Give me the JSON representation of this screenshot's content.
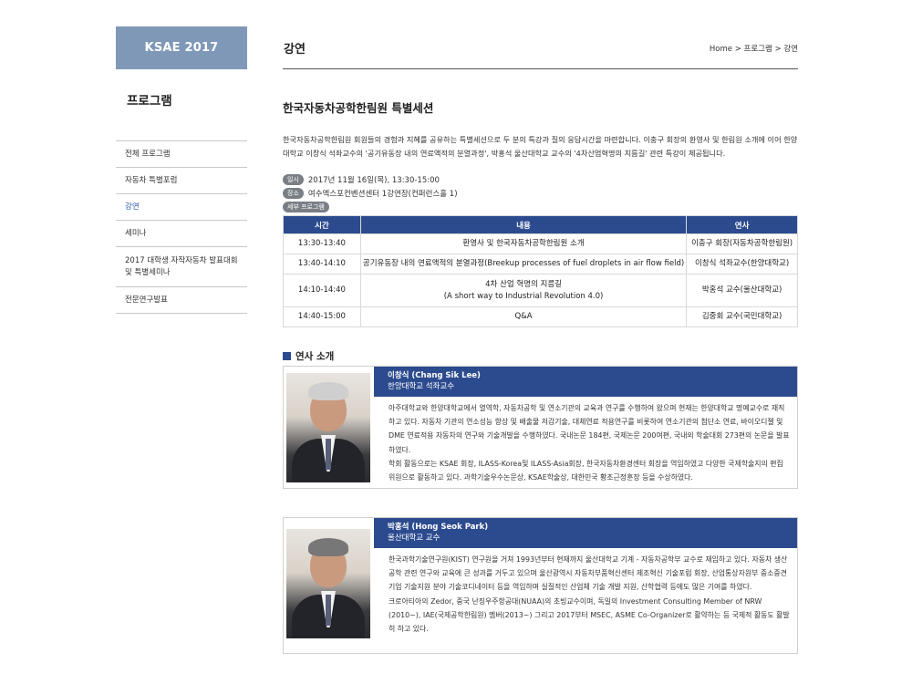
{
  "sidebar": {
    "logo": "KSAE 2017",
    "title": "프로그램",
    "items": [
      {
        "label": "전체 프로그램",
        "active": false
      },
      {
        "label": "자동차 특별포럼",
        "active": false
      },
      {
        "label": "강연",
        "active": true
      },
      {
        "label": "세미나",
        "active": false
      },
      {
        "label": "2017 대학생 자작자동차 발표대회 및 특별세미나",
        "active": false
      },
      {
        "label": "전문연구발표",
        "active": false
      }
    ]
  },
  "header": {
    "title": "강연",
    "breadcrumb": [
      "Home",
      "프로그램",
      "강연"
    ],
    "breadcrumb_sep": " > "
  },
  "section": {
    "title": "한국자동차공학한림원 특별세션",
    "intro": "한국자동차공학한림원 회원들의 경험과 지혜를 공유하는 특별세션으로 두 분의 특강과 질의 응답시간을 마련합니다. 이충구 회장의 환영사 및 한림원 소개에 이어 한양대학교 이창식 석좌교수의 '공기유동장 내의 연료액적의 분열과정', 박홍석 울산대학교 교수의 '4차산업혁명의 지름길' 관련 특강이 제공됩니다.",
    "date_tag": "일시",
    "date": "2017년 11월 16일(목), 13:30-15:00",
    "place_tag": "장소",
    "place": "여수엑스포컨벤션센터 1강연장(컨퍼런스홀 1)",
    "detail_tag": "세부 프로그램"
  },
  "schedule": {
    "headers": [
      "시간",
      "내용",
      "연사"
    ],
    "rows": [
      {
        "time": "13:30-13:40",
        "content": "환영사 및 한국자동차공학한림원 소개",
        "content2": "",
        "speaker": "이충구 회장(자동차공학한림원)"
      },
      {
        "time": "13:40-14:10",
        "content": "공기유동장 내의 연료액적의 분열과정(Breekup processes of fuel droplets in air flow field)",
        "content2": "",
        "speaker": "이창식 석좌교수(한양대학교)"
      },
      {
        "time": "14:10-14:40",
        "content": "4차 산업 혁명의 지름길",
        "content2": "(A short way to Industrial Revolution 4.0)",
        "speaker": "박홍석 교수(울산대학교)"
      },
      {
        "time": "14:40-15:00",
        "content": "Q&A",
        "content2": "",
        "speaker": "김중회 교수(국민대학교)"
      }
    ]
  },
  "speakers_heading": "연사 소개",
  "speakers": [
    {
      "name": "이창식 (Chang Sik Lee)",
      "affiliation": "한양대학교 석좌교수",
      "bio": "아주대학교와 한양대학교에서 열역학, 자동차공학 및 연소기관의 교육과 연구를 수행하여 왔으며 현재는 한양대학교 명예교수로 재직하고 있다. 자동차 기관의 연소성능 향상 및 배출물 저감기술, 대체연료 적용연구를 비롯하여 연소기관의 첨단소 연료, 바이오디젤 및 DME 연료적용 자동차의 연구와 기술개발을 수행하였다. 국내논문 184편, 국제논문 200여편, 국내외 학술대회 273편의 논문을 발표하였다.\n학회 활동으로는 KSAE 회장, ILASS-Korea및 ILASS-Asia회장, 한국자동차환경센터 회장을 역임하였고 다양한 국제학술지의 편집위원으로 활동하고 있다. 과학기술우수논문상, KSAE학술상, 대한민국 황조근정훈장 등을 수상하였다."
    },
    {
      "name": "박홍석 (Hong Seok Park)",
      "affiliation": "울산대학교 교수",
      "bio": "한국과학기술연구원(KIST) 연구원을 거쳐 1993년부터 현재까지 울산대학교 기계 - 자동차공학부 교수로 재임하고 있다. 자동차 생산공학 관련 연구와 교육에 큰 성과를 거두고 있으며 울산광역시 자동차부품혁신센터 제조혁신 기술포럼 회장, 산업통상자원부 중소중견기업 기술지원 분야 기술코디네이터 등을 역임하며 실질적인 산업체 기술 개발 지원, 산학협력 등에도 많은 기여를 하였다.\n크로아티아의 Zedor, 중국 난징우주항공대(NUAA)의 초빙교수이며, 독일의 Investment Consulting Member of NRW (2010~), IAE(국제공학한림원) 멤버(2013~) 그리고 2017부터 MSEC, ASME Co-Organizer로 활약하는 등 국제적 활동도 활발히 하고 있다."
    }
  ],
  "colors": {
    "accent": "#2c4b8f",
    "logo_bg": "#7f98b8",
    "active_link": "#2d5aa6"
  }
}
